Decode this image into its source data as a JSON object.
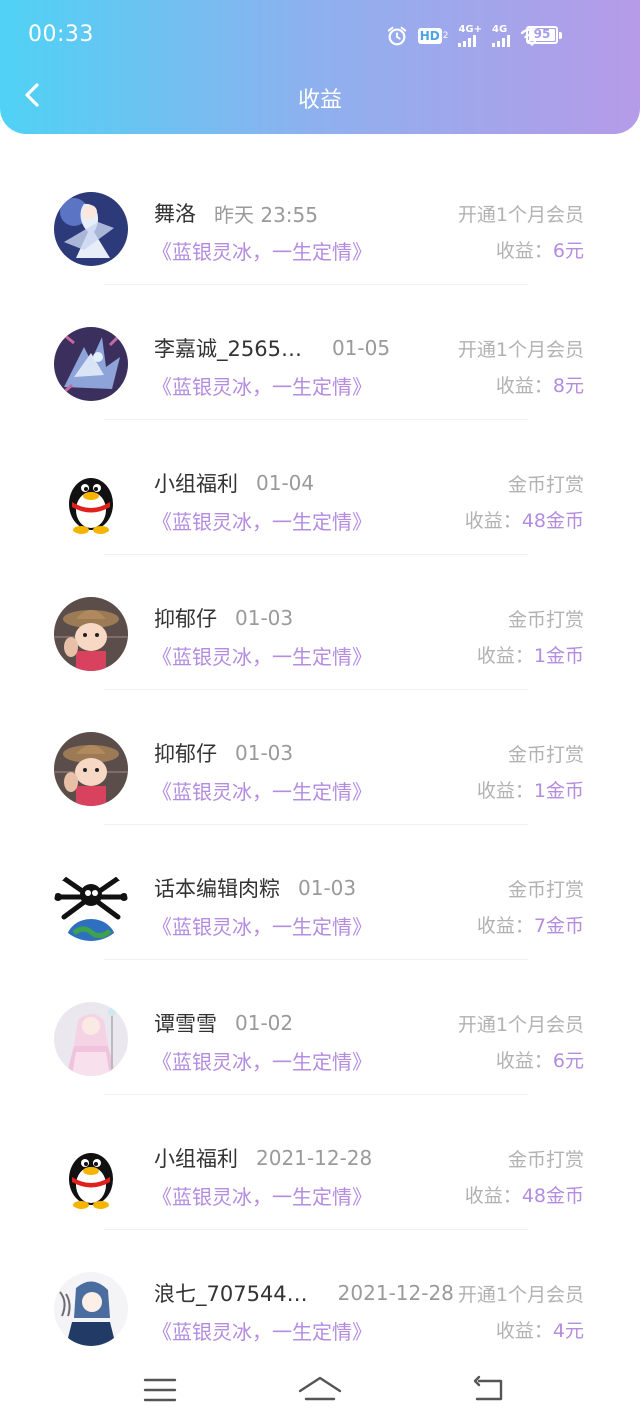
{
  "status": {
    "time": "00:33",
    "hd_label": "HD",
    "hd_sub": "2",
    "net1": "4G+",
    "net2": "4G",
    "battery": "95"
  },
  "header": {
    "title": "收益"
  },
  "items": [
    {
      "name": "舞洛",
      "date": "昨天 23:55",
      "book": "《蓝银灵冰，一生定情》",
      "type": "开通1个月会员",
      "earning_label": "收益：",
      "earning_value": "6元",
      "avatar": "avatar-anime-girl-white"
    },
    {
      "name": "李嘉诚_2565…",
      "date": "01-05",
      "book": "《蓝银灵冰，一生定情》",
      "type": "开通1个月会员",
      "earning_label": "收益：",
      "earning_value": "8元",
      "avatar": "avatar-ice-dragon"
    },
    {
      "name": "小组福利",
      "date": "01-04",
      "book": "《蓝银灵冰，一生定情》",
      "type": "金币打赏",
      "earning_label": "收益：",
      "earning_value": "48金币",
      "avatar": "avatar-qq-penguin"
    },
    {
      "name": "抑郁仔",
      "date": "01-03",
      "book": "《蓝银灵冰，一生定情》",
      "type": "金币打赏",
      "earning_label": "收益：",
      "earning_value": "1金币",
      "avatar": "avatar-cartoon-boy"
    },
    {
      "name": "抑郁仔",
      "date": "01-03",
      "book": "《蓝银灵冰，一生定情》",
      "type": "金币打赏",
      "earning_label": "收益：",
      "earning_value": "1金币",
      "avatar": "avatar-cartoon-boy"
    },
    {
      "name": "话本编辑肉粽",
      "date": "01-03",
      "book": "《蓝银灵冰，一生定情》",
      "type": "金币打赏",
      "earning_label": "收益：",
      "earning_value": "7金币",
      "avatar": "avatar-spider-earth"
    },
    {
      "name": "谭雪雪",
      "date": "01-02",
      "book": "《蓝银灵冰，一生定情》",
      "type": "开通1个月会员",
      "earning_label": "收益：",
      "earning_value": "6元",
      "avatar": "avatar-anime-girl-pink"
    },
    {
      "name": "小组福利",
      "date": "2021-12-28",
      "book": "《蓝银灵冰，一生定情》",
      "type": "金币打赏",
      "earning_label": "收益：",
      "earning_value": "48金币",
      "avatar": "avatar-qq-penguin"
    },
    {
      "name": "浪七_707544…",
      "date": "2021-12-28",
      "book": "《蓝银灵冰，一生定情》",
      "type": "开通1个月会员",
      "earning_label": "收益：",
      "earning_value": "4元",
      "avatar": "avatar-anime-boy-sketch"
    }
  ],
  "navbar": {
    "menu_icon": "menu-icon",
    "home_icon": "home-icon",
    "back_icon": "back-icon"
  }
}
